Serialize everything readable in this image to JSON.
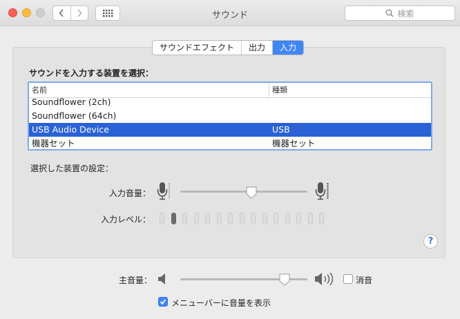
{
  "window": {
    "title": "サウンド",
    "search_placeholder": "検索"
  },
  "tabs": [
    {
      "label": "サウンドエフェクト",
      "active": false
    },
    {
      "label": "出力",
      "active": false
    },
    {
      "label": "入力",
      "active": true
    }
  ],
  "device_section": {
    "title": "サウンドを入力する装置を選択：",
    "columns": [
      "名前",
      "種類"
    ],
    "rows": [
      {
        "name": "Soundflower (2ch)",
        "type": "",
        "selected": false
      },
      {
        "name": "Soundflower (64ch)",
        "type": "",
        "selected": false
      },
      {
        "name": "USB Audio Device",
        "type": "USB",
        "selected": true
      },
      {
        "name": "機器セット",
        "type": "機器セット",
        "selected": false
      }
    ]
  },
  "settings": {
    "title": "選択した装置の設定：",
    "input_volume_label": "入力音量：",
    "input_volume": 0.56,
    "input_level_label": "入力レベル：",
    "input_level_segments": 15,
    "input_level_active": 1
  },
  "output": {
    "volume_label": "主音量：",
    "volume": 0.82,
    "mute_label": "消音",
    "mute": false,
    "menubar_label": "メニューバーに音量を表示",
    "menubar_checked": true
  },
  "colors": {
    "accent": "#3f86f5",
    "selection": "#2a62d5"
  },
  "icons": [
    "back-icon",
    "forward-icon",
    "grid-icon",
    "search-icon",
    "mic-icon",
    "speaker-low-icon",
    "speaker-high-icon",
    "help-icon",
    "checkmark-icon"
  ]
}
